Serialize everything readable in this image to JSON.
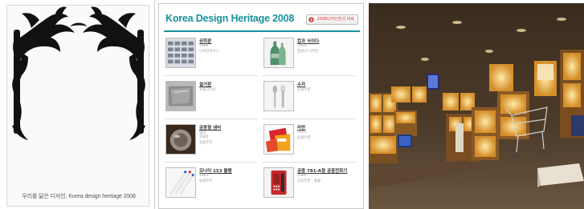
{
  "cover": {
    "caption": "우리를 닮은 디자인, Korea design heritage 2008",
    "art_icon": "phoenix-ornament-icon",
    "art_color": "#111111"
  },
  "page": {
    "title": "Korea Design Heritage 2008",
    "title_color": "#18929b",
    "button_label": "2008디자인한국 바로",
    "button_icon": "arrow-icon",
    "items": [
      {
        "name": "권희판",
        "meta": [
          "1988",
          "디자인하우스",
          ""
        ],
        "thumb_icon": "keyboard-icon"
      },
      {
        "name": "컵과 사이다",
        "meta": [
          "1950",
          "칠성사 디자인",
          ""
        ],
        "thumb_icon": "bottle-icon"
      },
      {
        "name": "설거판",
        "meta": [
          "",
          "흔들디자인",
          ""
        ],
        "thumb_icon": "tray-icon"
      },
      {
        "name": "수저",
        "meta": [
          "",
          "동물부문",
          ""
        ],
        "thumb_icon": "utensils-icon"
      },
      {
        "name": "공동형 냄비",
        "meta": [
          "냄비",
          "1965",
          "동물부문"
        ],
        "thumb_icon": "pot-icon"
      },
      {
        "name": "라면",
        "meta": [
          "1963",
          "동물부문",
          ""
        ],
        "thumb_icon": "noodle-icon"
      },
      {
        "name": "모나미 153 볼펜",
        "meta": [
          "1963",
          "동물부문",
          ""
        ],
        "thumb_icon": "pen-icon"
      },
      {
        "name": "공중 781-A형 공중전화기",
        "meta": [
          "1986",
          "공중부문 - 통통",
          ""
        ],
        "thumb_icon": "phone-icon"
      }
    ]
  },
  "photo": {
    "alt": "",
    "icon": "exhibition-photo-icon"
  }
}
